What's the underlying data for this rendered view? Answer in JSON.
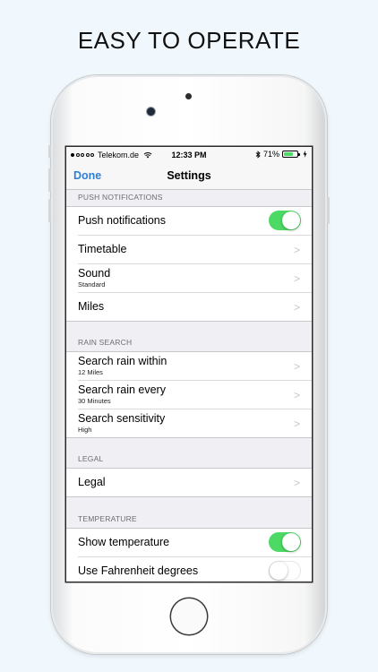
{
  "headline": "EASY TO OPERATE",
  "status_bar": {
    "carrier": "Telekom.de",
    "time": "12:33 PM",
    "battery": "71%",
    "battery_level": 0.71,
    "icons": [
      "signal-dots-icon",
      "wifi-icon",
      "bluetooth-icon",
      "battery-icon",
      "charging-bolt-icon"
    ]
  },
  "navbar": {
    "done_label": "Done",
    "title": "Settings"
  },
  "sections": {
    "push": {
      "header": "PUSH NOTIFICATIONS",
      "rows": [
        {
          "title": "Push notifications",
          "toggle": true
        },
        {
          "title": "Timetable"
        },
        {
          "title": "Sound",
          "subtitle": "Standard"
        },
        {
          "title": "Miles"
        }
      ]
    },
    "rain": {
      "header": "RAIN SEARCH",
      "rows": [
        {
          "title": "Search rain within",
          "subtitle": "12 Miles"
        },
        {
          "title": "Search rain every",
          "subtitle": "30 Minutes"
        },
        {
          "title": "Search sensitivity",
          "subtitle": "High"
        }
      ]
    },
    "legal": {
      "header": "LEGAL",
      "rows": [
        {
          "title": "Legal"
        }
      ]
    },
    "temperature": {
      "header": "TEMPERATURE",
      "rows": [
        {
          "title": "Show temperature",
          "toggle": true
        },
        {
          "title": "Use Fahrenheit degrees",
          "toggle": false
        }
      ]
    }
  },
  "colors": {
    "accent": "#2f7fd4",
    "toggle_on": "#4cd964",
    "background": "#efeff4"
  }
}
